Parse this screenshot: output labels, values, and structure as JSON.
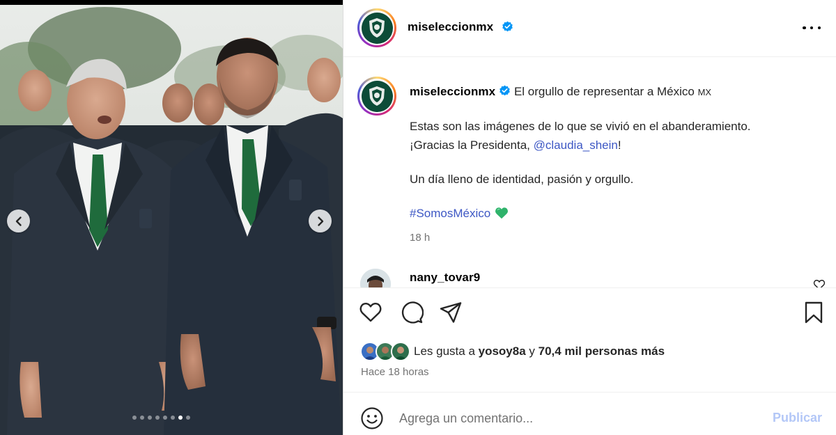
{
  "post": {
    "username": "miseleccionmx",
    "verified": true,
    "more_icon": "more-horizontal-icon"
  },
  "media": {
    "carousel_total": 8,
    "carousel_active_index": 6,
    "prev_icon": "chevron-left-icon",
    "next_icon": "chevron-right-icon"
  },
  "caption": {
    "username": "miseleccionmx",
    "line1": "El orgullo de representar a México",
    "flag_text": "MX",
    "line2": "Estas son las imágenes de lo que se vivió en el abanderamiento.",
    "line3_prefix": "¡Gracias la Presidenta, ",
    "mention": "@claudia_shein",
    "line3_suffix": "!",
    "line4": "Un día lleno de identidad, pasión y orgullo.",
    "hashtag": "#SomosMéxico",
    "hashtag_emoji": "green-heart-icon",
    "time": "18 h"
  },
  "reply": {
    "username": "nany_tovar9"
  },
  "actions": {
    "like_icon": "heart-icon",
    "comment_icon": "comment-icon",
    "share_icon": "send-icon",
    "save_icon": "bookmark-icon"
  },
  "likes": {
    "prefix": "Les gusta a ",
    "user": "yosoy8a",
    "middle": " y ",
    "count": "70,4 mil personas más"
  },
  "date": "Hace 18 horas",
  "comment_box": {
    "placeholder": "Agrega un comentario...",
    "publish_label": "Publicar",
    "emoji_icon": "smiley-icon"
  },
  "colors": {
    "accent_link": "#3d57c4",
    "publish_disabled": "#b3c7f7",
    "badge_blue": "#0095f6",
    "brand_green": "#0c4c38"
  }
}
